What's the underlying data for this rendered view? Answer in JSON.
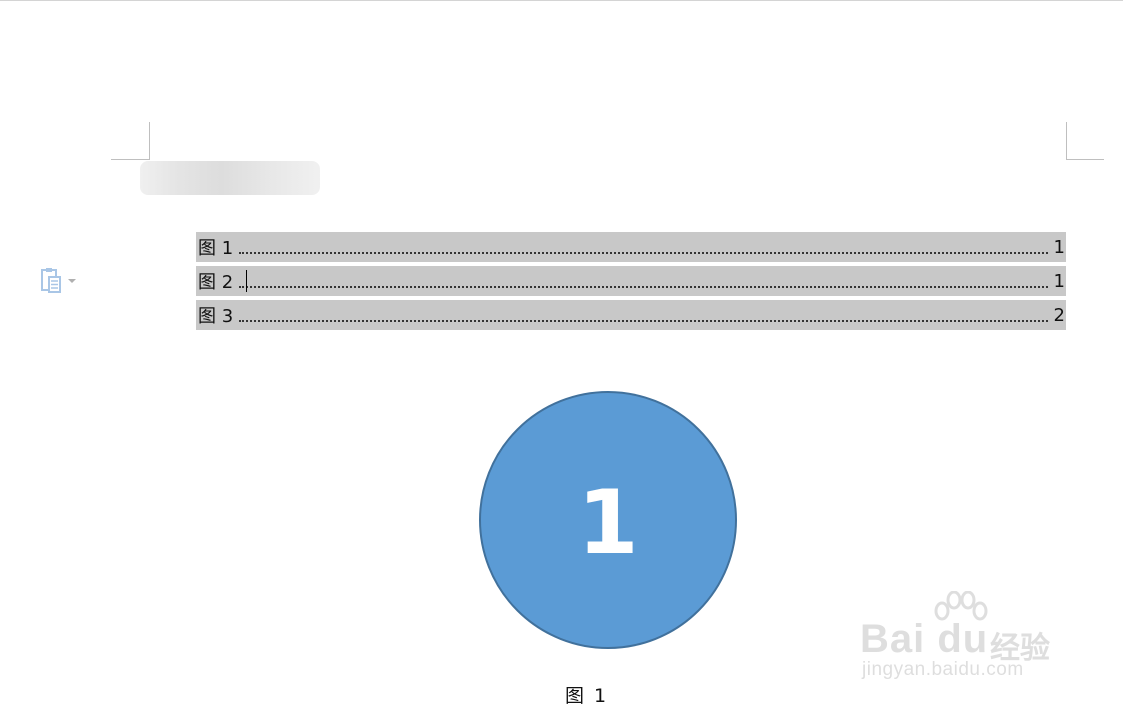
{
  "toc": {
    "entries": [
      {
        "label": "图 1",
        "page": "1"
      },
      {
        "label": "图 2",
        "page": "1"
      },
      {
        "label": "图 3",
        "page": "2"
      }
    ]
  },
  "figure": {
    "number": "1",
    "caption": "图 1",
    "fill_color": "#5b9bd5",
    "stroke_color": "#41719c"
  },
  "icons": {
    "paste_options": "paste-options-icon",
    "dropdown": "chevron-down-icon"
  },
  "watermark": {
    "brand": "Bai du",
    "product": "经验",
    "url": "jingyan.baidu.com"
  },
  "colors": {
    "toc_highlight": "#c8c8c8",
    "paste_icon": "#a9c6e6"
  }
}
